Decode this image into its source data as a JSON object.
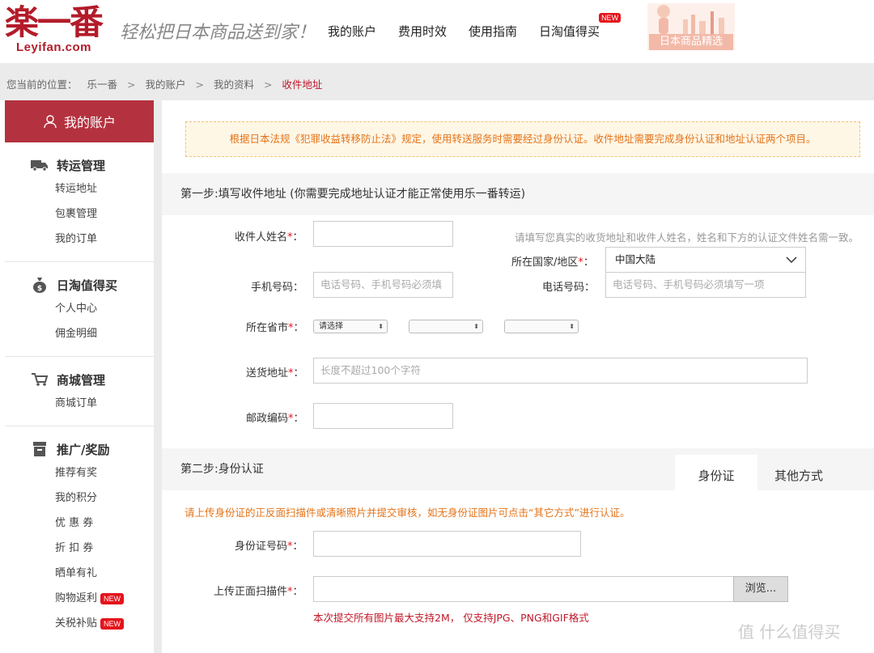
{
  "header": {
    "logo_main": "楽一番",
    "logo_sub": "Leyifan.com",
    "slogan": "轻松把日本商品送到家！",
    "nav": [
      {
        "label": "我的账户"
      },
      {
        "label": "费用时效"
      },
      {
        "label": "使用指南"
      },
      {
        "label": "日淘值得买",
        "badge": "NEW"
      }
    ],
    "promo_text": "日本商品精选"
  },
  "breadcrumb": {
    "prefix": "您当前的位置：",
    "items": [
      "乐一番",
      "我的账户",
      "我的资料",
      "收件地址"
    ],
    "separator": ">"
  },
  "sidebar": {
    "header": "我的账户",
    "sections": [
      {
        "title": "转运管理",
        "icon": "truck-icon",
        "items": [
          {
            "label": "转运地址"
          },
          {
            "label": "包裹管理"
          },
          {
            "label": "我的订单"
          }
        ]
      },
      {
        "title": "日淘值得买",
        "icon": "money-bag-icon",
        "items": [
          {
            "label": "个人中心"
          },
          {
            "label": "佣金明细"
          }
        ]
      },
      {
        "title": "商城管理",
        "icon": "cart-icon",
        "items": [
          {
            "label": "商城订单"
          }
        ]
      },
      {
        "title": "推广/奖励",
        "icon": "gift-box-icon",
        "items": [
          {
            "label": "推荐有奖"
          },
          {
            "label": "我的积分"
          },
          {
            "label": "优 惠 券"
          },
          {
            "label": "折 扣 券"
          },
          {
            "label": "晒单有礼"
          },
          {
            "label": "购物返利",
            "badge": "NEW"
          },
          {
            "label": "关税补贴",
            "badge": "NEW"
          }
        ]
      }
    ]
  },
  "notice": "根据日本法规《犯罪收益转移防止法》规定，使用转送服务时需要经过身份认证。收件地址需要完成身份认证和地址认证两个项目。",
  "step1": {
    "title": "第一步:填写收件地址 (你需要完成地址认证才能正常使用乐一番转运)",
    "name_label": "收件人姓名",
    "name_hint": "请填写您真实的收货地址和收件人姓名，姓名和下方的认证文件姓名需一致。",
    "country_label": "所在国家/地区",
    "country_value": "中国大陆",
    "mobile_label": "手机号码",
    "mobile_placeholder": "电话号码、手机号码必须填",
    "phone_label": "电话号码",
    "phone_placeholder": "电话号码、手机号码必须填写一项",
    "province_label": "所在省市",
    "province_default": "请选择",
    "address_label": "送货地址",
    "address_placeholder": "长度不超过100个字符",
    "zip_label": "邮政编码",
    "colon": "：",
    "required_mark": "*"
  },
  "step2": {
    "title": "第二步:身份认证",
    "tabs": [
      "身份证",
      "其他方式"
    ],
    "note": "请上传身份证的正反面扫描件或清晰照片并提交审核，如无身份证图片可点击“其它方式”进行认证。",
    "id_label": "身份证号码",
    "upload_label": "上传正面扫描件",
    "browse": "浏览...",
    "upload_note": "本次提交所有图片最大支持2M， 仅支持JPG、PNG和GIF格式"
  },
  "watermark": "值 什么值得买",
  "colors": {
    "brand_red": "#b31c2a",
    "sidebar_head": "#b4323f",
    "orange": "#e4741a"
  }
}
